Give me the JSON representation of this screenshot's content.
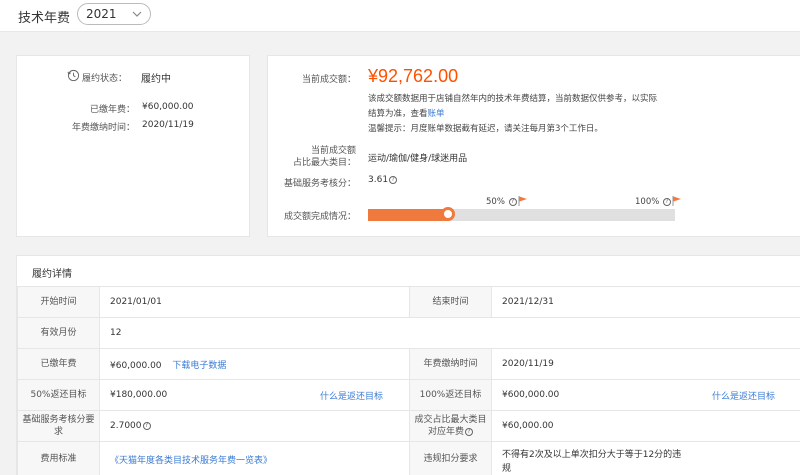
{
  "header": {
    "title": "技术年费",
    "year": "2021"
  },
  "summary": {
    "status_label": "履约状态：",
    "status_value": "履约中",
    "paid_label": "已缴年费：",
    "paid_value": "¥60,000.00",
    "pay_time_label": "年费缴纳时间：",
    "pay_time_value": "2020/11/19"
  },
  "deal": {
    "amount_label": "当前成交额：",
    "amount": "¥92,762.00",
    "note_line1": "该成交额数据用于店铺自然年内的技术年费结算，当前数据仅供参考，以实际",
    "note_line2_prefix": "结算为准，查看",
    "note_line2_link": "账单",
    "note_line3": "温馨提示：月度账单数据截有延迟，请关注每月第3个工作日。",
    "category_label_1": "当前成交额",
    "category_label_2": "占比最大类目：",
    "category_value": "运动/瑜伽/健身/球迷用品",
    "score_label": "基础服务考核分：",
    "score_value": "3.61",
    "progress_label": "成交额完成情况：",
    "progress_fraction": 0.26,
    "milestone_50": "50%",
    "milestone_100": "100%"
  },
  "details": {
    "title": "履约详情",
    "start_label": "开始时间",
    "start_value": "2021/01/01",
    "end_label": "结束时间",
    "end_value": "2021/12/31",
    "months_label": "有效月份",
    "months_value": "12",
    "paid_label": "已缴年费",
    "paid_value": "¥60,000.00",
    "download_link": "下载电子数据",
    "pay_time_label": "年费缴纳时间",
    "pay_time_value": "2020/11/19",
    "rebate50_label": "50%返还目标",
    "rebate50_value": "¥180,000.00",
    "what_is_rebate_1": "什么是返还目标",
    "rebate100_label": "100%返还目标",
    "rebate100_value": "¥600,000.00",
    "what_is_rebate_2": "什么是返还目标",
    "score_req_label": "基础服务考核分要求",
    "score_req_value": "2.7000",
    "category_fee_label_1": "成交占比最大类目",
    "category_fee_label_2": "对应年费",
    "category_fee_value": "¥60,000.00",
    "fee_std_label": "费用标准",
    "fee_std_link": "《天猫年度各类目技术服务年费一览表》",
    "violation_label": "违规扣分要求",
    "violation_value_1": "不得有2次及以上单次扣分大于等于12分的违",
    "violation_value_2": "规"
  },
  "colors": {
    "accent": "#ff5000",
    "progress": "#f07a3e",
    "link": "#3a7bd5"
  }
}
